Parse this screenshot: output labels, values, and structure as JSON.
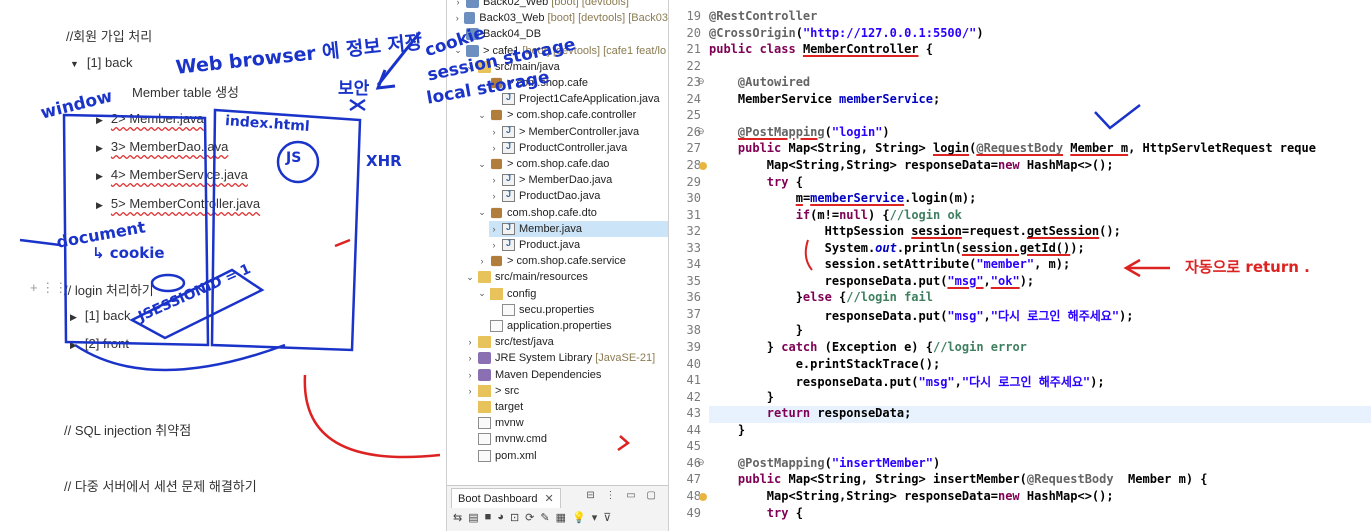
{
  "notes": {
    "section1_title": "//회원 가입 처리",
    "back_item": "[1] back",
    "member_table": "Member table 생성",
    "file_items": [
      "2> Member.java",
      "3> MemberDao.java",
      "4> MemberService.java",
      "5> MemberController.java"
    ],
    "section2_title": "// login 처리하기",
    "login_back": "[1] back",
    "login_front": "[2] front",
    "sql_note": "// SQL injection 취약점",
    "multi_server_note": "// 다중 서버에서 세션 문제 해결하기"
  },
  "handwriting": {
    "browser_note": "Web browser 에 정보 저장",
    "cookie": "cookie",
    "session_storage": "session storage",
    "local_storage": "local storage",
    "security": "보안",
    "x_mark": "X",
    "window": "window",
    "index_html": "index.html",
    "js": "JS",
    "xhr": "XHR",
    "document": "document",
    "cookie_arrow": "↳ cookie",
    "jsessionid": "JSESSIONID = 1",
    "auto_return": "자동으로 return ."
  },
  "explorer": {
    "rows": [
      {
        "label": "Back02_Web",
        "meta": "[boot] [devtools]",
        "icon": "project",
        "arrow": "›",
        "indent": 0
      },
      {
        "label": "Back03_Web",
        "meta": "[boot] [devtools] [Back03",
        "icon": "project",
        "arrow": "›",
        "indent": 0
      },
      {
        "label": "Back04_DB",
        "meta": "",
        "icon": "project",
        "arrow": "›",
        "indent": 0
      },
      {
        "label": "> cafe1",
        "meta": "[boot] [devtools] [cafe1 feat/lo",
        "icon": "project",
        "arrow": "⌄",
        "indent": 0
      },
      {
        "label": "src/main/java",
        "meta": "",
        "icon": "srcfolder",
        "arrow": "⌄",
        "indent": 1
      },
      {
        "label": "> com.shop.cafe",
        "meta": "",
        "icon": "package",
        "arrow": "⌄",
        "indent": 2
      },
      {
        "label": "Project1CafeApplication.java",
        "meta": "",
        "icon": "javafile",
        "arrow": "",
        "indent": 3
      },
      {
        "label": "> com.shop.cafe.controller",
        "meta": "",
        "icon": "package",
        "arrow": "⌄",
        "indent": 2
      },
      {
        "label": "> MemberController.java",
        "meta": "",
        "icon": "javafile",
        "arrow": "›",
        "indent": 3
      },
      {
        "label": "ProductController.java",
        "meta": "",
        "icon": "javafile",
        "arrow": "›",
        "indent": 3
      },
      {
        "label": "> com.shop.cafe.dao",
        "meta": "",
        "icon": "package",
        "arrow": "⌄",
        "indent": 2
      },
      {
        "label": "> MemberDao.java",
        "meta": "",
        "icon": "javafile",
        "arrow": "›",
        "indent": 3
      },
      {
        "label": "ProductDao.java",
        "meta": "",
        "icon": "javafile",
        "arrow": "›",
        "indent": 3
      },
      {
        "label": "com.shop.cafe.dto",
        "meta": "",
        "icon": "package",
        "arrow": "⌄",
        "indent": 2
      },
      {
        "label": "Member.java",
        "meta": "",
        "icon": "javafile",
        "arrow": "›",
        "indent": 3,
        "selected": true
      },
      {
        "label": "Product.java",
        "meta": "",
        "icon": "javafile",
        "arrow": "›",
        "indent": 3
      },
      {
        "label": "> com.shop.cafe.service",
        "meta": "",
        "icon": "package",
        "arrow": "›",
        "indent": 2
      },
      {
        "label": "src/main/resources",
        "meta": "",
        "icon": "srcfolder",
        "arrow": "⌄",
        "indent": 1
      },
      {
        "label": "config",
        "meta": "",
        "icon": "folder",
        "arrow": "⌄",
        "indent": 2
      },
      {
        "label": "secu.properties",
        "meta": "",
        "icon": "file",
        "arrow": "",
        "indent": 3
      },
      {
        "label": "application.properties",
        "meta": "",
        "icon": "file",
        "arrow": "",
        "indent": 2
      },
      {
        "label": "src/test/java",
        "meta": "",
        "icon": "srcfolder",
        "arrow": "›",
        "indent": 1
      },
      {
        "label": "JRE System Library",
        "meta": "[JavaSE-21]",
        "icon": "lib",
        "arrow": "›",
        "indent": 1
      },
      {
        "label": "Maven Dependencies",
        "meta": "",
        "icon": "lib",
        "arrow": "›",
        "indent": 1
      },
      {
        "label": "> src",
        "meta": "",
        "icon": "folder",
        "arrow": "›",
        "indent": 1
      },
      {
        "label": "target",
        "meta": "",
        "icon": "folder",
        "arrow": "",
        "indent": 1
      },
      {
        "label": "mvnw",
        "meta": "",
        "icon": "file",
        "arrow": "",
        "indent": 1
      },
      {
        "label": "mvnw.cmd",
        "meta": "",
        "icon": "file",
        "arrow": "",
        "indent": 1
      },
      {
        "label": "pom.xml",
        "meta": "",
        "icon": "file",
        "arrow": "",
        "indent": 1
      }
    ]
  },
  "boot_dashboard": {
    "tab_label": "Boot Dashboard",
    "close": "✕",
    "controls": "⊟ ⋮ ▭ ▢",
    "toolbar": [
      "⇆",
      "▤",
      "■",
      "◕",
      "⊡",
      "⟳",
      "✎",
      "▦",
      "💡",
      "▾",
      "⊽"
    ]
  },
  "editor": {
    "lines": [
      {
        "n": "19",
        "html": "<span class=\"ann\">@RestController</span>"
      },
      {
        "n": "20",
        "html": "<span class=\"ann\">@CrossOrigin</span>(<span class=\"str\">\"http://127.0.0.1:5500/\"</span>)"
      },
      {
        "n": "21",
        "html": "<span class=\"kw\">public class</span> <span class=\"u-red\">MemberController</span> {"
      },
      {
        "n": "22",
        "html": ""
      },
      {
        "n": "23",
        "html": "    <span class=\"ann\">@Autowired</span>",
        "mark": true
      },
      {
        "n": "24",
        "html": "    MemberService <span class=\"fld\">memberService</span>;"
      },
      {
        "n": "25",
        "html": ""
      },
      {
        "n": "26",
        "html": "    <span class=\"ann u-red\">@PostMapping</span>(<span class=\"str\">\"login\"</span>)",
        "mark": true
      },
      {
        "n": "27",
        "html": "    <span class=\"kw\">public</span> Map&lt;String, String&gt; <span class=\"u-red\">login</span>(<span class=\"ann u-red\">@RequestBody</span> <span class=\"u-red\">Member m</span>, HttpServletRequest reque"
      },
      {
        "n": "28",
        "html": "        Map&lt;String,String&gt; responseData=<span class=\"kw\">new</span> HashMap&lt;&gt;();",
        "warn": true
      },
      {
        "n": "29",
        "html": "        <span class=\"kw\">try</span> {"
      },
      {
        "n": "30",
        "html": "            <span class=\"u-red\">m</span>=<span class=\"fld u-red\">memberService</span>.login(m);"
      },
      {
        "n": "31",
        "html": "            <span class=\"kw\">if</span>(m!=<span class=\"kw\">null</span>) {<span class=\"cmt\">//login ok</span>"
      },
      {
        "n": "32",
        "html": "                HttpSession <span class=\"u-red\">session</span>=request.<span class=\"u-red\">getSession</span>();"
      },
      {
        "n": "33",
        "html": "                System.<span class=\"ital\">out</span>.println(<span class=\"u-red\">session.getId()</span>);"
      },
      {
        "n": "34",
        "html": "                session.setAttribute(<span class=\"str\">\"member\"</span>, m);"
      },
      {
        "n": "35",
        "html": "                responseData.put(<span class=\"str u-red\">\"msg\"</span>,<span class=\"str u-red\">\"ok\"</span>);"
      },
      {
        "n": "36",
        "html": "            }<span class=\"kw\">else</span> {<span class=\"cmt\">//login fail</span>"
      },
      {
        "n": "37",
        "html": "                responseData.put(<span class=\"str\">\"msg\"</span>,<span class=\"str\">\"다시 로그인 해주세요\"</span>);"
      },
      {
        "n": "38",
        "html": "            }"
      },
      {
        "n": "39",
        "html": "        } <span class=\"kw\">catch</span> (Exception e) {<span class=\"cmt\">//login error</span>"
      },
      {
        "n": "40",
        "html": "            e.printStackTrace();"
      },
      {
        "n": "41",
        "html": "            responseData.put(<span class=\"str\">\"msg\"</span>,<span class=\"str\">\"다시 로그인 해주세요\"</span>);"
      },
      {
        "n": "42",
        "html": "        }"
      },
      {
        "n": "43",
        "html": "        <span class=\"kw\">return</span> responseData;",
        "current": true
      },
      {
        "n": "44",
        "html": "    }"
      },
      {
        "n": "45",
        "html": ""
      },
      {
        "n": "46",
        "html": "    <span class=\"ann\">@PostMapping</span>(<span class=\"str\">\"insertMember\"</span>)",
        "mark": true
      },
      {
        "n": "47",
        "html": "    <span class=\"kw\">public</span> Map&lt;String, String&gt; insertMember(<span class=\"ann\">@RequestBody</span>  Member m) {"
      },
      {
        "n": "48",
        "html": "        Map&lt;String,String&gt; responseData=<span class=\"kw\">new</span> HashMap&lt;&gt;();",
        "warn": true
      },
      {
        "n": "49",
        "html": "        <span class=\"kw\">try</span> {"
      }
    ]
  }
}
